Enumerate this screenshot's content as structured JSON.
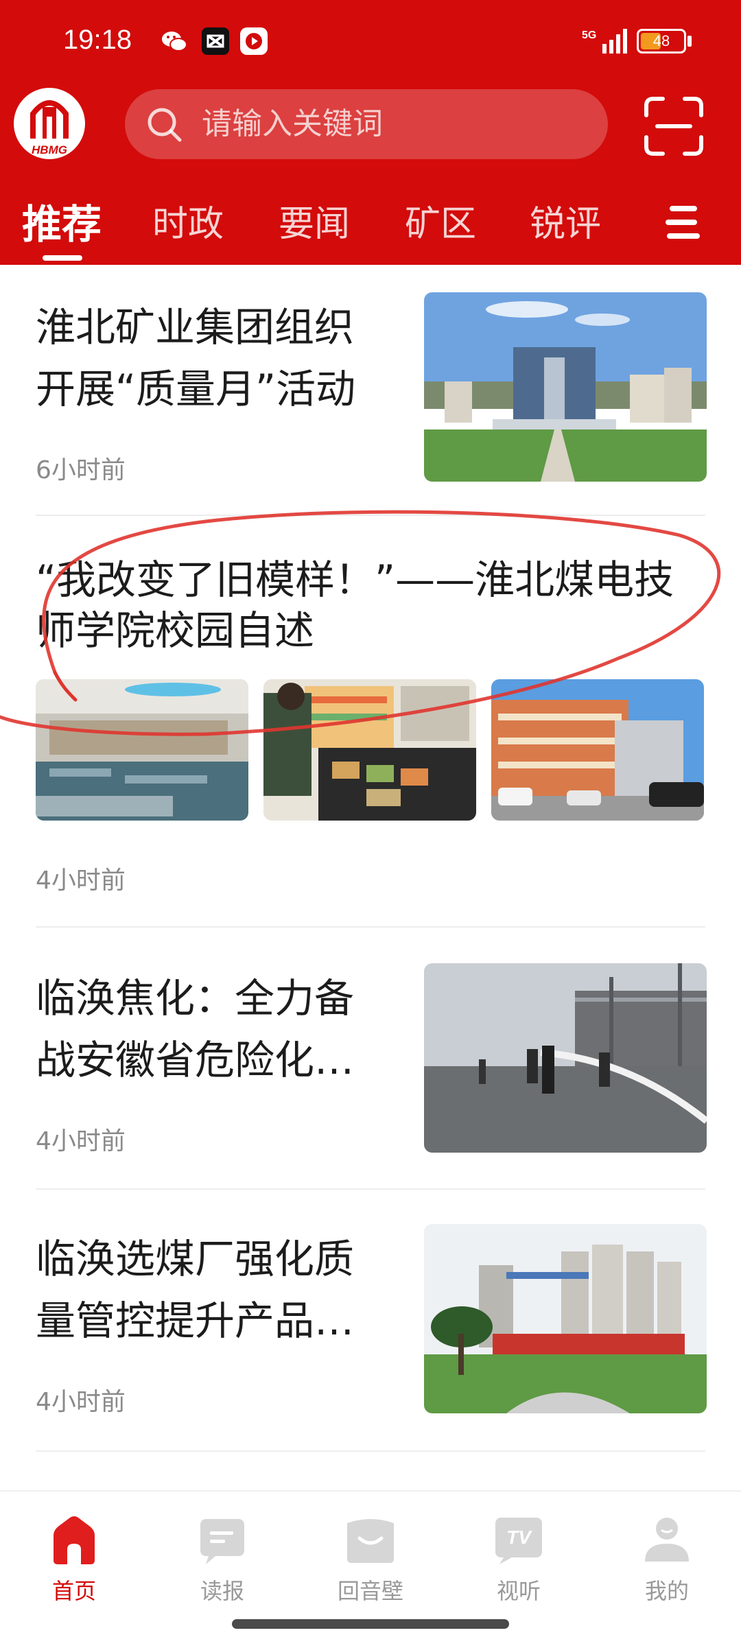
{
  "status_bar": {
    "time": "19:18",
    "network": "5G",
    "battery": "48",
    "battery_level": 0.48
  },
  "header": {
    "logo_text": "HBMG",
    "search_placeholder": "请输入关键词",
    "tabs": [
      {
        "label": "推荐",
        "active": true
      },
      {
        "label": "时政",
        "active": false
      },
      {
        "label": "要闻",
        "active": false
      },
      {
        "label": "矿区",
        "active": false
      },
      {
        "label": "锐评",
        "active": false
      }
    ]
  },
  "articles": [
    {
      "title_lines": [
        "淮北矿业集团组织",
        "开展“质量月”活动"
      ],
      "time": "6小时前",
      "image": "office-building-photo"
    },
    {
      "title_lines": [
        "“我改变了旧模样！”——淮北煤电技",
        "师学院校园自述"
      ],
      "time": "4小时前",
      "images": [
        "canteen-photo",
        "food-counter-photo",
        "campus-building-photo"
      ]
    },
    {
      "title_lines": [
        "临涣焦化：全力备",
        "战安徽省危险化…"
      ],
      "time": "4小时前",
      "image": "fire-drill-photo"
    },
    {
      "title_lines": [
        "临涣选煤厂强化质",
        "量管控提升产品…"
      ],
      "time": "4小时前",
      "image": "coal-silo-photo"
    }
  ],
  "bottom_nav": [
    {
      "label": "首页",
      "icon": "home-icon",
      "active": true
    },
    {
      "label": "读报",
      "icon": "newspaper-icon",
      "active": false
    },
    {
      "label": "回音壁",
      "icon": "echo-wall-icon",
      "active": false
    },
    {
      "label": "视听",
      "icon": "tv-icon",
      "active": false
    },
    {
      "label": "我的",
      "icon": "profile-icon",
      "active": false
    }
  ],
  "colors": {
    "brand_red": "#d30b0b",
    "annotation_red": "#e0352f",
    "inactive_gray": "#999999"
  }
}
